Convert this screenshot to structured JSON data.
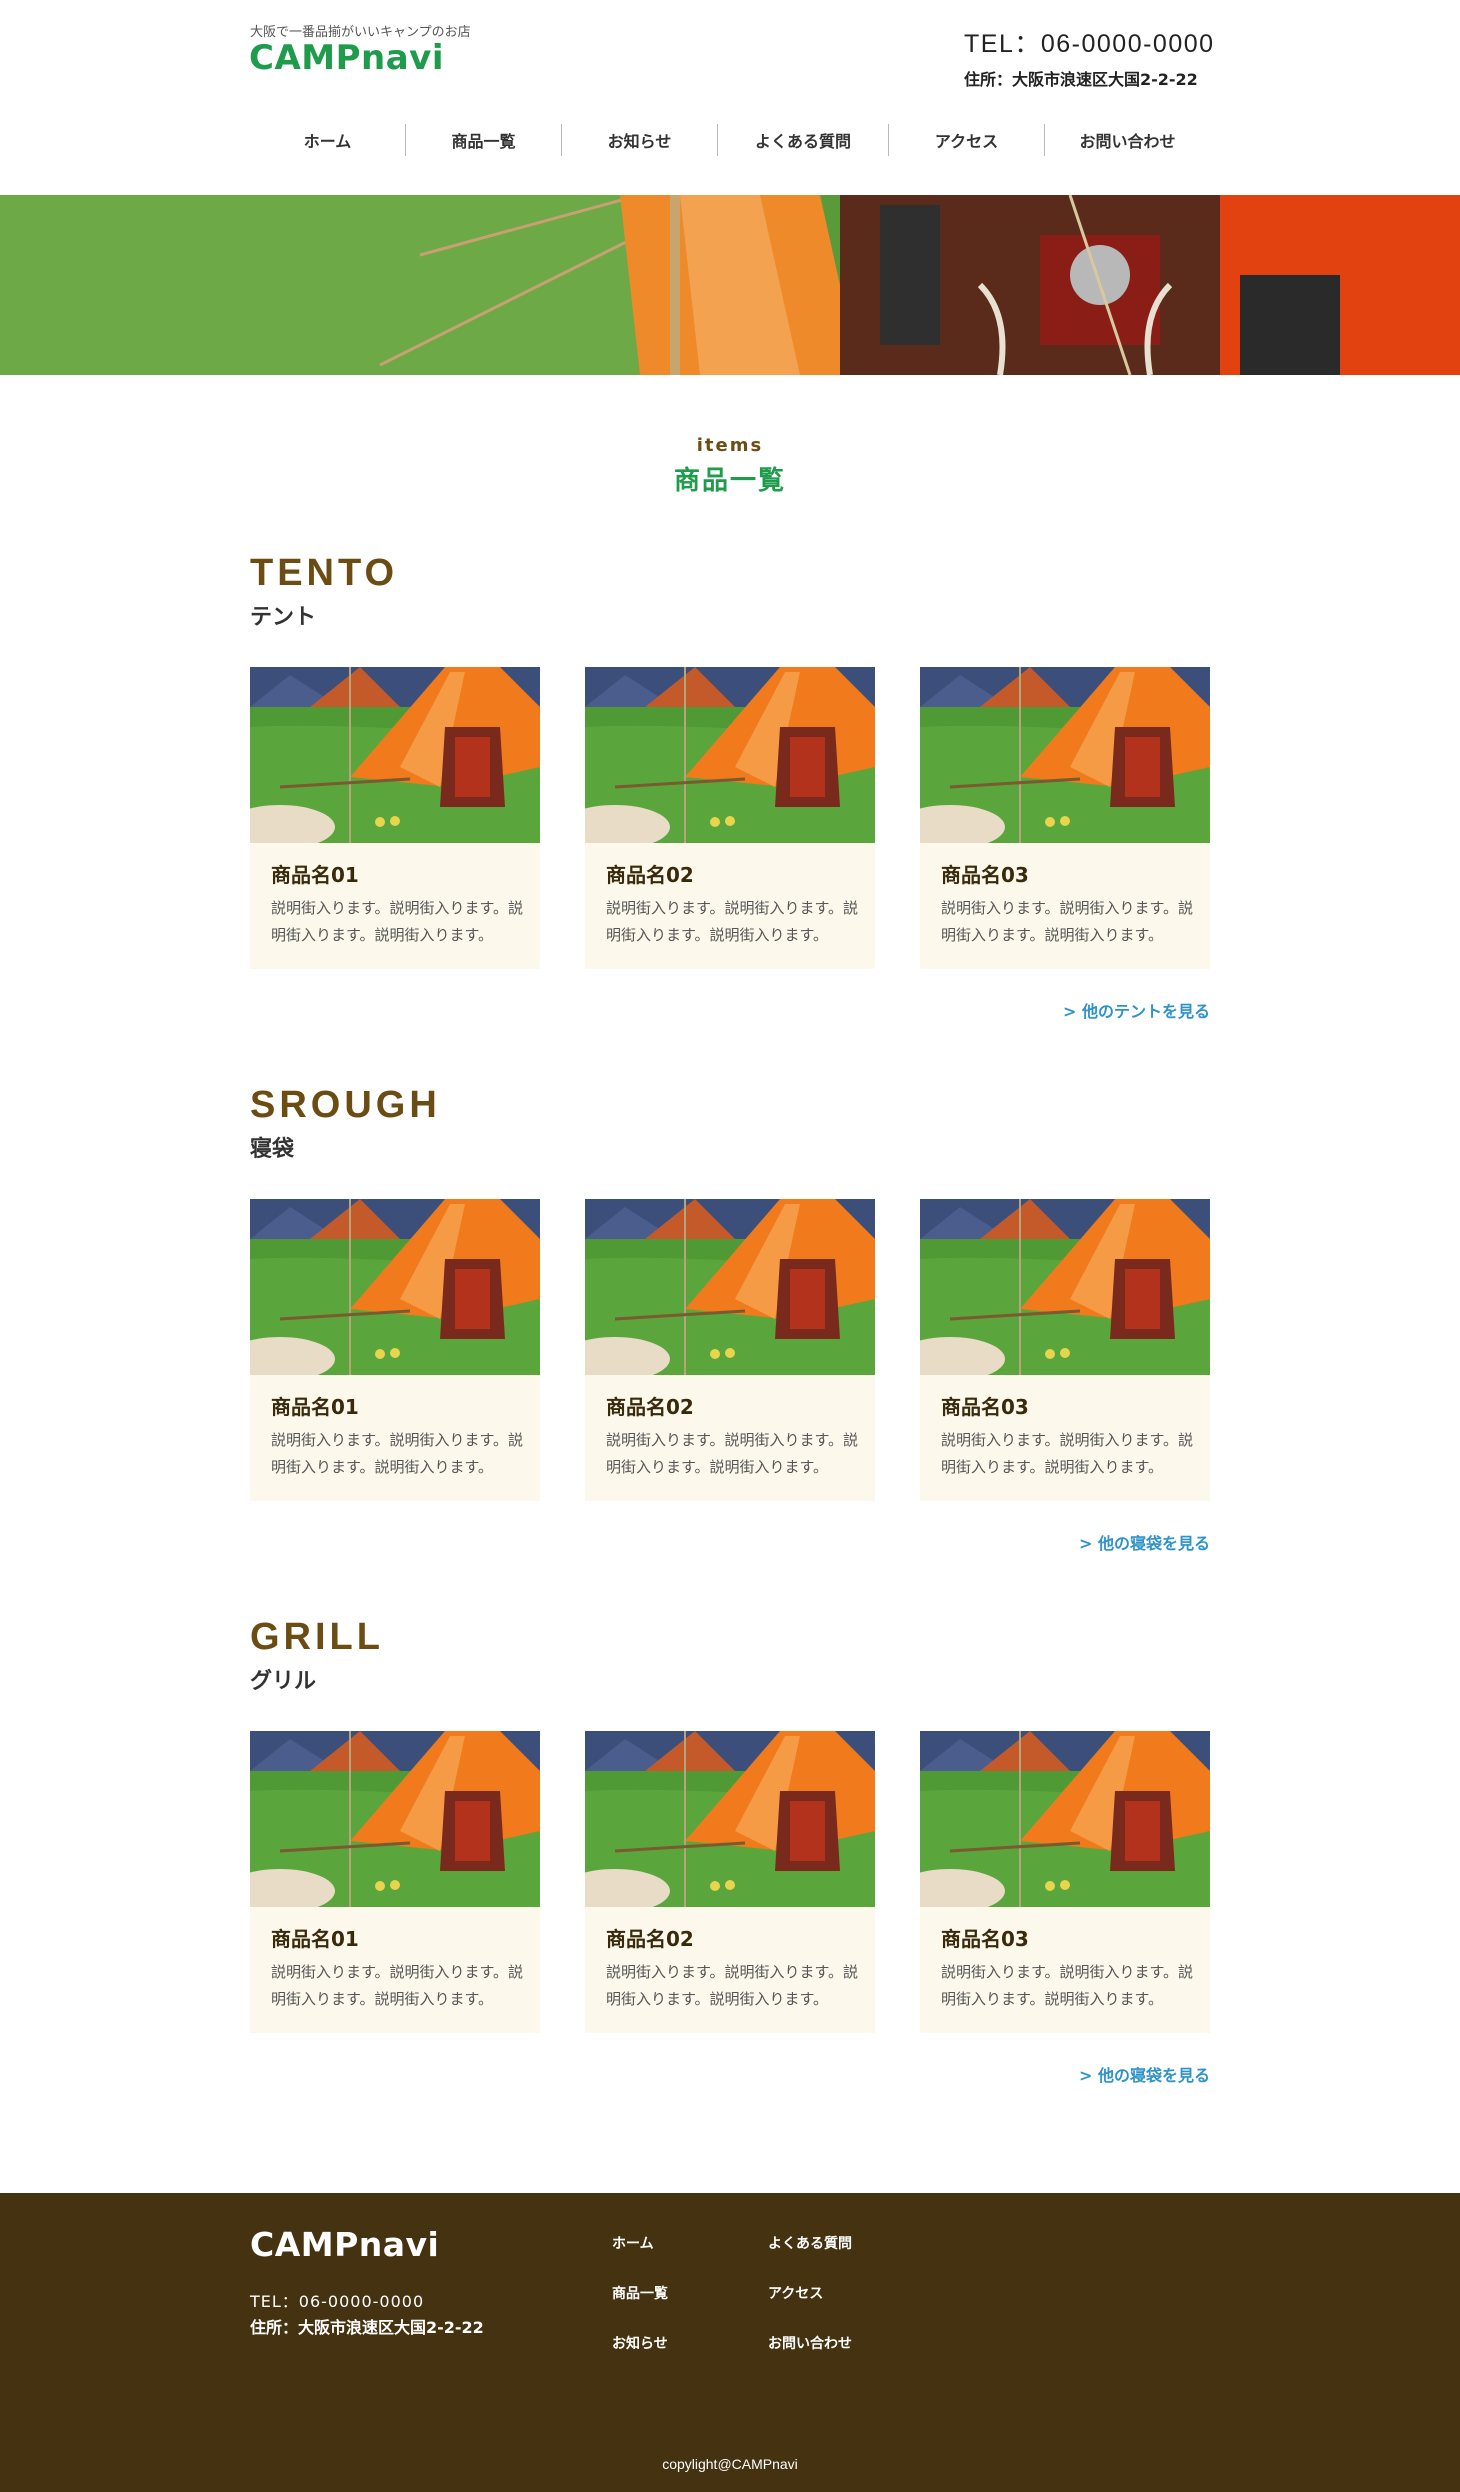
{
  "header": {
    "tagline": "大阪で一番品揃がいいキャンプのお店",
    "logo": "CAMPnavi",
    "tel": "TEL：06-0000-0000",
    "address": "住所：大阪市浪速区大国2-2-22"
  },
  "nav": [
    "ホーム",
    "商品一覧",
    "お知らせ",
    "よくある質問",
    "アクセス",
    "お問い合わせ"
  ],
  "hero": {
    "image": "tent-camp-photo"
  },
  "page_title": {
    "en": "items",
    "ja": "商品一覧"
  },
  "categories": [
    {
      "en": "TENTO",
      "ja": "テント",
      "items": [
        {
          "name": "商品名01",
          "desc": "説明街入ります。説明街入ります。説明街入ります。説明街入ります。"
        },
        {
          "name": "商品名02",
          "desc": "説明街入ります。説明街入ります。説明街入ります。説明街入ります。"
        },
        {
          "name": "商品名03",
          "desc": "説明街入ります。説明街入ります。説明街入ります。説明街入ります。"
        }
      ],
      "more": "> 他のテントを見る"
    },
    {
      "en": "SROUGH",
      "ja": "寝袋",
      "items": [
        {
          "name": "商品名01",
          "desc": "説明街入ります。説明街入ります。説明街入ります。説明街入ります。"
        },
        {
          "name": "商品名02",
          "desc": "説明街入ります。説明街入ります。説明街入ります。説明街入ります。"
        },
        {
          "name": "商品名03",
          "desc": "説明街入ります。説明街入ります。説明街入ります。説明街入ります。"
        }
      ],
      "more": "> 他の寝袋を見る"
    },
    {
      "en": "GRILL",
      "ja": "グリル",
      "items": [
        {
          "name": "商品名01",
          "desc": "説明街入ります。説明街入ります。説明街入ります。説明街入ります。"
        },
        {
          "name": "商品名02",
          "desc": "説明街入ります。説明街入ります。説明街入ります。説明街入ります。"
        },
        {
          "name": "商品名03",
          "desc": "説明街入ります。説明街入ります。説明街入ります。説明街入ります。"
        }
      ],
      "more": "> 他の寝袋を見る"
    }
  ],
  "footer": {
    "logo": "CAMPnavi",
    "tel": "TEL：06-0000-0000",
    "address": "住所：大阪市浪速区大国2-2-22",
    "links": [
      "ホーム",
      "商品一覧",
      "お知らせ",
      "よくある質問",
      "アクセス",
      "お問い合わせ"
    ],
    "copyright": "copylight@CAMPnavi"
  },
  "colors": {
    "brand_green": "#1e9b4b",
    "brown": "#6b4c13",
    "footer_bg": "#443211",
    "card_bg": "#fcf9ec",
    "link_blue": "#2e93c8"
  }
}
